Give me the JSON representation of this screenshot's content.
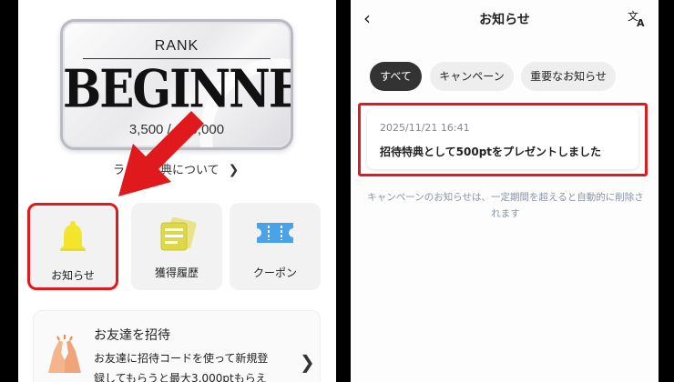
{
  "left": {
    "rank": {
      "label": "RANK",
      "name": "BEGINNER",
      "points": "3,500 / 100,000"
    },
    "benefit_link": "ランク特典について",
    "tiles": [
      {
        "label": "お知らせ",
        "icon": "bell-icon"
      },
      {
        "label": "獲得履歴",
        "icon": "history-icon"
      },
      {
        "label": "クーポン",
        "icon": "coupon-icon"
      }
    ],
    "invite": {
      "title": "お友達を招待",
      "desc_line1": "お友達に招待コードを使って新規登",
      "desc_line2": "録してもらうと最大3,000ptもらえ"
    }
  },
  "right": {
    "header": {
      "title": "お知らせ",
      "back_icon": "chevron-left-icon",
      "translate_icon": "translate-icon"
    },
    "filters": [
      {
        "label": "すべて",
        "active": true
      },
      {
        "label": "キャンペーン",
        "active": false
      },
      {
        "label": "重要なお知らせ",
        "active": false
      }
    ],
    "notice": {
      "date": "2025/11/21 16:41",
      "text": "招待特典として500ptをプレゼントしました"
    },
    "note": "キャンペーンのお知らせは、一定期間を超えると自動的に削除されます"
  },
  "colors": {
    "highlight": "#e0191c",
    "bell": "#f3e52b",
    "coupon": "#4aa3e8",
    "active_chip": "#333333"
  }
}
